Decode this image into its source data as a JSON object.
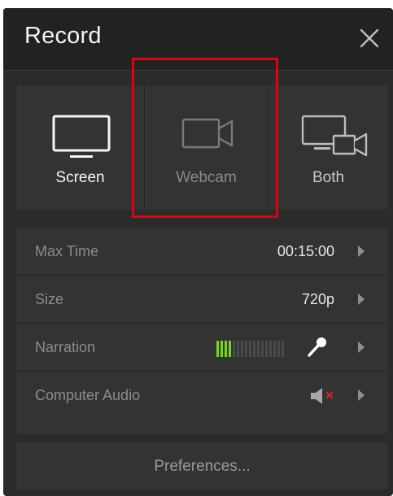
{
  "window": {
    "title": "Record"
  },
  "modes": [
    {
      "id": "screen",
      "label": "Screen",
      "icon": "monitor-icon"
    },
    {
      "id": "webcam",
      "label": "Webcam",
      "icon": "webcam-icon"
    },
    {
      "id": "both",
      "label": "Both",
      "icon": "screen-and-webcam-icon"
    }
  ],
  "settings": {
    "max_time": {
      "label": "Max Time",
      "value": "00:15:00"
    },
    "size": {
      "label": "Size",
      "value": "720p"
    },
    "narration": {
      "label": "Narration",
      "level_bars_active": 4,
      "level_bars_total": 17,
      "icon": "microphone-icon"
    },
    "computer_audio": {
      "label": "Computer Audio",
      "icon": "speaker-muted-icon"
    }
  },
  "preferences": {
    "label": "Preferences..."
  },
  "colors": {
    "panel": "#2b2b2b",
    "header": "#222222",
    "highlight": "#e3000f",
    "meter_active": "#7ed321",
    "meter_inactive": "#4a4a4a",
    "mute_x": "#e02020"
  }
}
